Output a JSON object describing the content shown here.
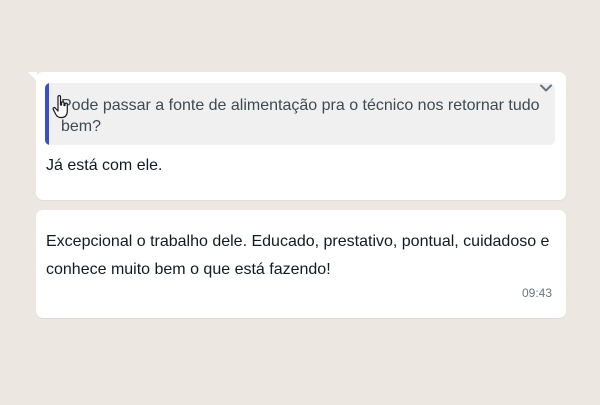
{
  "chat": {
    "background_color": "#ece8e1",
    "accent_color": "#3b4fc4",
    "messages": [
      {
        "quoted_text": "Pode passar a fonte de alimentação pra o técnico nos retornar tudo bem?",
        "text": "Já está com ele.",
        "menu_icon": "chevron-down-icon"
      },
      {
        "text": "Excepcional o trabalho dele. Educado, prestativo, pontual, cuidadoso e conhece muito bem o que está fazendo!",
        "time": "09:43"
      }
    ]
  },
  "cursor": {
    "icon": "hand-pointer-icon"
  }
}
